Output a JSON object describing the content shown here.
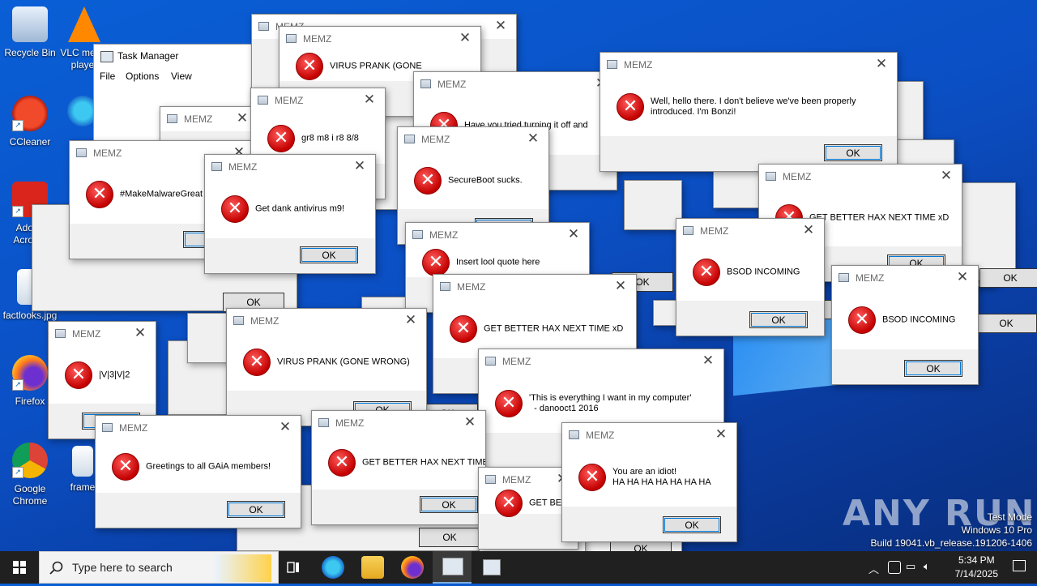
{
  "desktop": {
    "icons": [
      {
        "label": "Recycle Bin",
        "name": "recycle-bin-icon"
      },
      {
        "label": "VLC media player",
        "name": "vlc-icon"
      },
      {
        "label": "CCleaner",
        "name": "ccleaner-icon"
      },
      {
        "label": "Microsoft Edge",
        "name": "edge-desktop-icon"
      },
      {
        "label": "Adobe Acrobat",
        "name": "acrobat-icon"
      },
      {
        "label": "factlooks.jpg",
        "name": "image-file-icon"
      },
      {
        "label": "Firefox",
        "name": "firefox-desktop-icon"
      },
      {
        "label": "Google Chrome",
        "name": "chrome-icon"
      },
      {
        "label": "frame",
        "name": "frame-file-icon"
      }
    ]
  },
  "task_manager": {
    "title": "Task Manager",
    "menu": [
      "File",
      "Options",
      "View"
    ]
  },
  "memz_title": "MEMZ",
  "ok_label": "OK",
  "dialogs": [
    {
      "msg": "VIRUS PRANK (GONE"
    },
    {
      "msg": "Have you tried turning it off and"
    },
    {
      "msg": "Well, hello there. I don't believe we've been properly\nintroduced. I'm Bonzi!"
    },
    {
      "msg": "#MakeMalwareGreat"
    },
    {
      "msg": "gr8 m8 i r8 8/8"
    },
    {
      "msg": "Get dank antivirus m9!"
    },
    {
      "msg": "SecureBoot sucks."
    },
    {
      "msg": "GET BETTER HAX NEXT TIME xD"
    },
    {
      "msg": "Get dank antivirus m9!"
    },
    {
      "msg": "Insert lool quote here"
    },
    {
      "msg": "BSOD INCOMING"
    },
    {
      "msg": "GET BETTER HAX NEXT TIME xD"
    },
    {
      "msg": "BSOD INCOMING"
    },
    {
      "msg": "|V|3|V|2"
    },
    {
      "msg": "VIRUS PRANK (GONE WRONG)"
    },
    {
      "msg": "'This is everything I want in my computer'\n  - danooct1 2016"
    },
    {
      "msg": "Greetings to all GAiA members!"
    },
    {
      "msg": "GET BETTER HAX NEXT TIME xD"
    },
    {
      "msg": "GET BETTER HAX NEXT TIME xD"
    },
    {
      "msg": "You are an idiot!\nHA HA HA HA HA HA HA"
    }
  ],
  "taskbar": {
    "search_placeholder": "Type here to search",
    "time": "5:34 PM",
    "date": "7/14/2025"
  },
  "watermark": {
    "line1": "Test Mode",
    "line2": "Windows 10 Pro",
    "line3": "Build 19041.vb_release.191206-1406"
  },
  "brand": "ANY RUN"
}
